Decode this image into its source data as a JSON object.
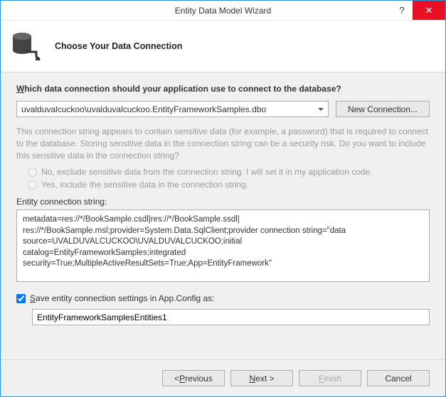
{
  "titlebar": {
    "title": "Entity Data Model Wizard",
    "help": "?",
    "close": "✕"
  },
  "header": {
    "title": "Choose Your Data Connection"
  },
  "question": "Which data connection should your application use to connect to the database?",
  "combo_value": "uvalduvalcuckoo\\uvalduvalcuckoo.EntityFrameworkSamples.dbo",
  "new_connection": "New Connection...",
  "warning_text": "This connection string appears to contain sensitive data (for example, a password) that is required to connect to the database. Storing sensitive data in the connection string can be a security risk. Do you want to include this sensitive data in the connection string?",
  "radio_no": "No, exclude sensitive data from the connection string. I will set it in my application code.",
  "radio_yes": "Yes, include the sensitive data in the connection string.",
  "ecs_label": "Entity connection string:",
  "ecs_line1": "metadata=res://*/BookSample.csdl|res://*/BookSample.ssdl|",
  "ecs_line2": "res://*/BookSample.msl;provider=System.Data.SqlClient;provider connection string=\"data",
  "ecs_line3": "source=UVALDUVALCUCKOO\\UVALDUVALCUCKOO;initial",
  "ecs_line4": "catalog=EntityFrameworkSamples;integrated",
  "ecs_line5": "security=True;MultipleActiveResultSets=True;App=EntityFramework\"",
  "save_label_pre": "S",
  "save_label_post": "ave entity connection settings in App.Config as:",
  "save_value": "EntityFrameworkSamplesEntities1",
  "buttons": {
    "previous_pre": "< ",
    "previous_u": "P",
    "previous_post": "revious",
    "next_u": "N",
    "next_post": "ext >",
    "finish_u": "F",
    "finish_post": "inish",
    "cancel": "Cancel"
  }
}
